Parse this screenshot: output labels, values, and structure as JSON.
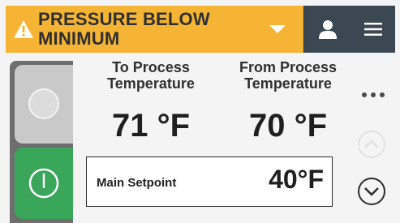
{
  "header": {
    "alarm_text": "PRESSURE BELOW MINIMUM",
    "alarm_color": "#f6b434",
    "icons": [
      "warning-icon",
      "chevron-down-icon",
      "user-icon",
      "menu-icon"
    ]
  },
  "readings": {
    "to_process": {
      "label": "To Process Temperature",
      "value": "71 °F"
    },
    "from_process": {
      "label": "From Process Temperature",
      "value": "70 °F"
    }
  },
  "setpoint": {
    "label": "Main Setpoint",
    "value": "40°F"
  },
  "controls": {
    "power_on_color": "#3aa65a",
    "power_off_color": "#c9c9c9",
    "icons": [
      "power-off-icon",
      "power-on-icon",
      "more-icon",
      "scroll-up-icon",
      "scroll-down-icon"
    ]
  }
}
